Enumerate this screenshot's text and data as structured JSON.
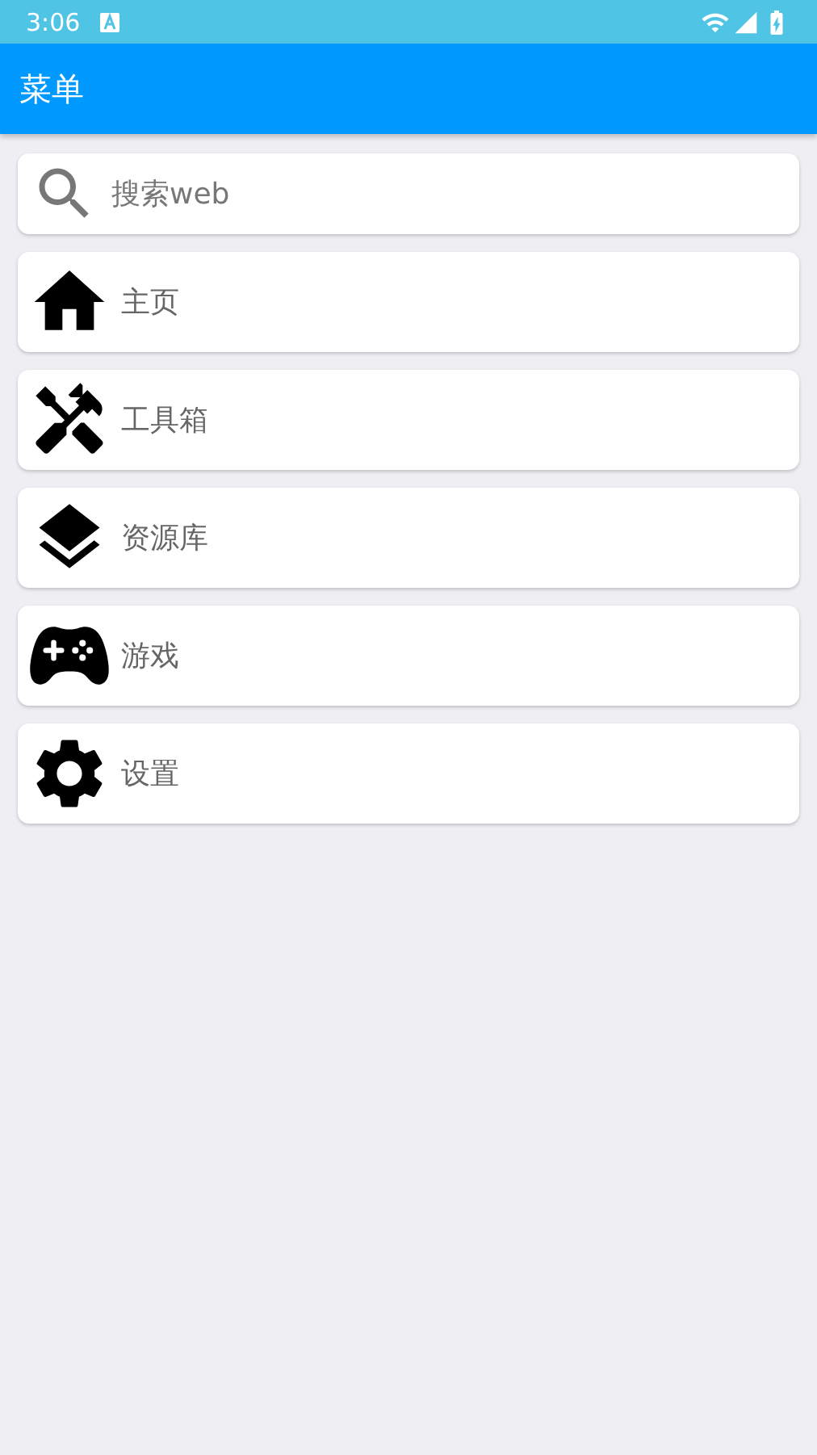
{
  "status_bar": {
    "time": "3:06"
  },
  "app_bar": {
    "title": "菜单"
  },
  "search": {
    "placeholder": "搜索web"
  },
  "menu": [
    {
      "label": "主页"
    },
    {
      "label": "工具箱"
    },
    {
      "label": "资源库"
    },
    {
      "label": "游戏"
    },
    {
      "label": "设置"
    }
  ]
}
